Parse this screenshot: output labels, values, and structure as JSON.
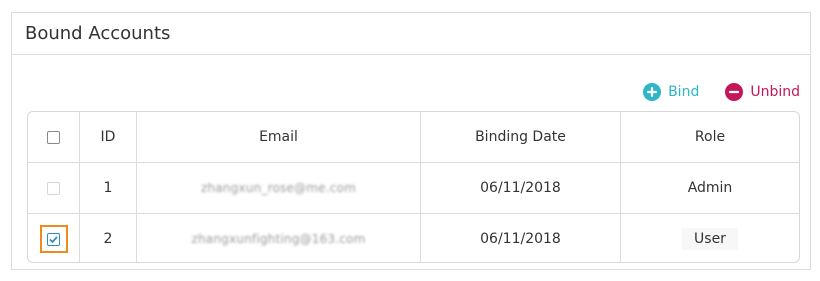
{
  "panel": {
    "title": "Bound Accounts"
  },
  "toolbar": {
    "bind_label": "Bind",
    "unbind_label": "Unbind",
    "bind_color": "#2fb5c9",
    "unbind_color": "#c2185b"
  },
  "table": {
    "headers": {
      "id": "ID",
      "email": "Email",
      "binding_date": "Binding Date",
      "role": "Role"
    },
    "rows": [
      {
        "checked": false,
        "disabled": true,
        "id": "1",
        "email": "zhangxun_rose@me.com",
        "binding_date": "06/11/2018",
        "role": "Admin"
      },
      {
        "checked": true,
        "disabled": false,
        "id": "2",
        "email": "zhangxunfighting@163.com",
        "binding_date": "06/11/2018",
        "role": "User"
      }
    ]
  },
  "colors": {
    "accent": "#2fb5c9",
    "danger": "#c2185b",
    "focus": "#f08a1c"
  }
}
